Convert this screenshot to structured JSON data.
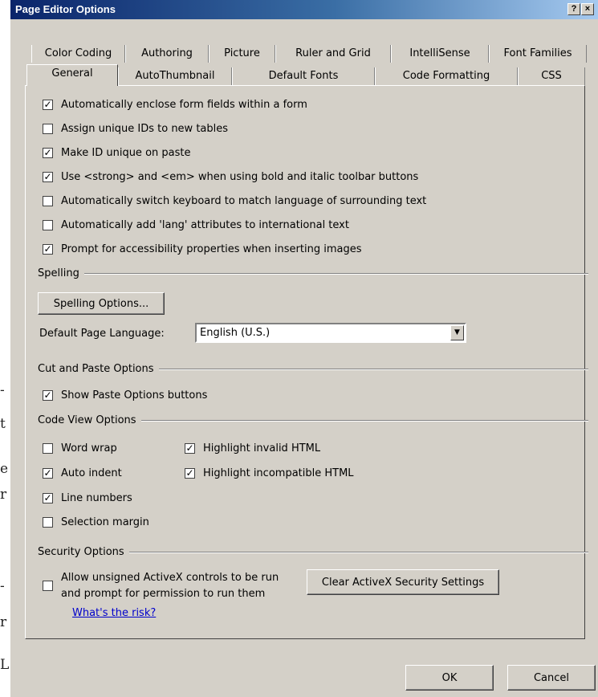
{
  "dialog": {
    "title": "Page Editor Options",
    "help_label": "?",
    "close_label": "×"
  },
  "tabs_row1": [
    "Color Coding",
    "Authoring",
    "Picture",
    "Ruler and Grid",
    "IntelliSense",
    "Font Families"
  ],
  "tabs_row2": [
    "General",
    "AutoThumbnail",
    "Default Fonts",
    "Code Formatting",
    "CSS"
  ],
  "active_tab": "General",
  "general_options": [
    {
      "label": "Automatically enclose form fields within a form",
      "checked": true
    },
    {
      "label": "Assign unique IDs to new tables",
      "checked": false
    },
    {
      "label": "Make ID unique on paste",
      "checked": true
    },
    {
      "label": "Use <strong> and <em> when using bold and italic toolbar buttons",
      "checked": true
    },
    {
      "label": "Automatically switch keyboard to match language of surrounding text",
      "checked": false
    },
    {
      "label": "Automatically add 'lang' attributes to international text",
      "checked": false
    },
    {
      "label": "Prompt for accessibility properties when inserting images",
      "checked": true
    }
  ],
  "spelling": {
    "heading": "Spelling",
    "button_label": "Spelling Options...",
    "language_label": "Default Page Language:",
    "language_value": "English (U.S.)"
  },
  "cut_paste": {
    "heading": "Cut and Paste Options",
    "options": [
      {
        "label": "Show Paste Options buttons",
        "checked": true
      }
    ]
  },
  "code_view": {
    "heading": "Code View Options",
    "left_options": [
      {
        "label": "Word wrap",
        "checked": false
      },
      {
        "label": "Auto indent",
        "checked": true
      },
      {
        "label": "Line numbers",
        "checked": true
      },
      {
        "label": "Selection margin",
        "checked": false
      }
    ],
    "right_options": [
      {
        "label": "Highlight invalid HTML",
        "checked": true
      },
      {
        "label": "Highlight incompatible HTML",
        "checked": true
      }
    ]
  },
  "security": {
    "heading": "Security Options",
    "activex_label_line1": "Allow unsigned ActiveX controls to be run",
    "activex_label_line2": "and prompt for permission to run them",
    "activex_checked": false,
    "risk_link": "What's the risk?",
    "clear_button": "Clear ActiveX Security Settings"
  },
  "footer": {
    "ok_label": "OK",
    "cancel_label": "Cancel"
  }
}
